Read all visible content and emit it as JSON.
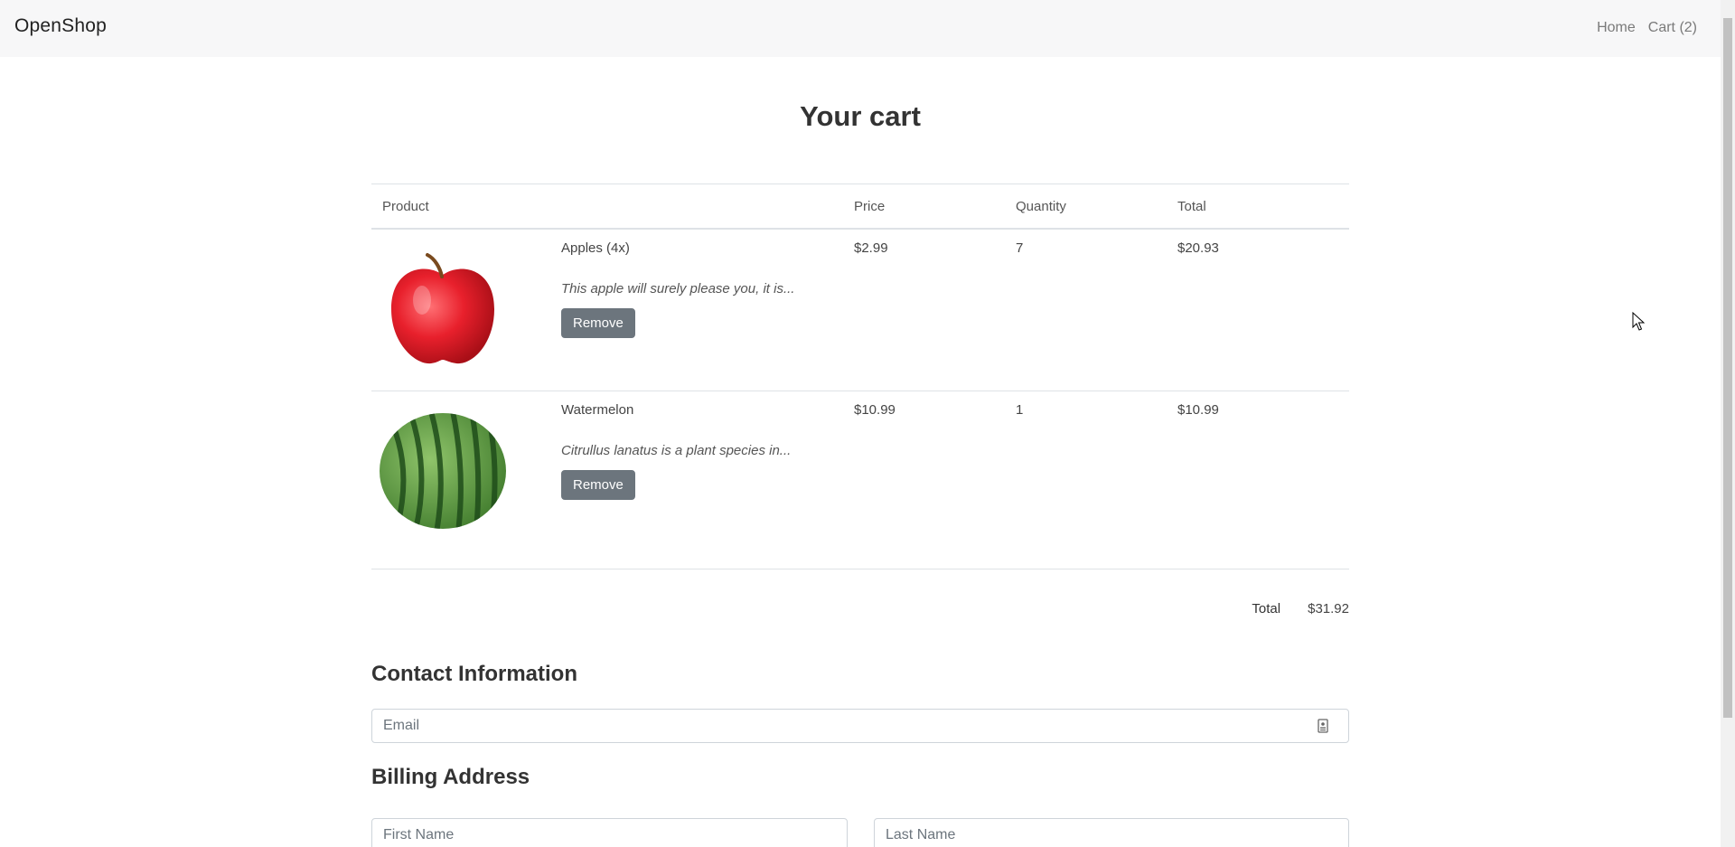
{
  "navbar": {
    "brand": "OpenShop",
    "links": [
      {
        "label": "Home"
      },
      {
        "label": "Cart (2)"
      }
    ]
  },
  "page": {
    "title": "Your cart"
  },
  "table": {
    "headers": {
      "product": "Product",
      "price": "Price",
      "quantity": "Quantity",
      "total": "Total"
    },
    "items": [
      {
        "name": "Apples (4x)",
        "description": "This apple will surely please you, it is...",
        "price": "$2.99",
        "quantity": "7",
        "total": "$20.93",
        "remove_label": "Remove",
        "image_icon": "apple-image"
      },
      {
        "name": "Watermelon",
        "description": "Citrullus lanatus is a plant species in...",
        "price": "$10.99",
        "quantity": "1",
        "total": "$10.99",
        "remove_label": "Remove",
        "image_icon": "watermelon-image"
      }
    ]
  },
  "summary": {
    "total_label": "Total",
    "total_value": "$31.92"
  },
  "contact": {
    "heading": "Contact Information",
    "email_placeholder": "Email"
  },
  "billing": {
    "heading": "Billing Address",
    "first_name_placeholder": "First Name",
    "last_name_placeholder": "Last Name"
  },
  "colors": {
    "button_bg": "#6c757d",
    "navbar_bg": "#f7f7f8",
    "border": "#dee2e6"
  }
}
